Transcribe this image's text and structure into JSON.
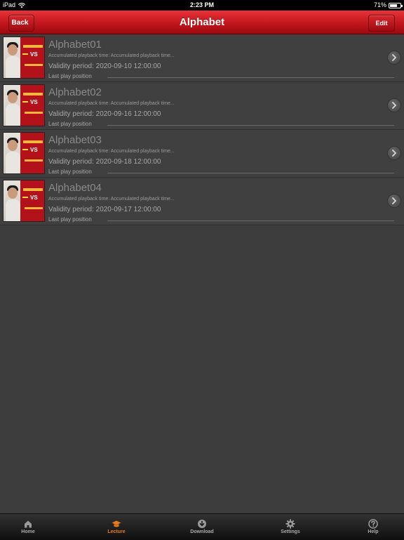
{
  "status_bar": {
    "device": "iPad",
    "time": "2:23 PM",
    "battery_text": "71%",
    "battery_level": 0.71
  },
  "nav": {
    "back_label": "Back",
    "title": "Alphabet",
    "edit_label": "Edit"
  },
  "lectures": [
    {
      "title": "Alphabet01",
      "playback": "Accumulated playback time: Accumulated playback time...",
      "validity": "Validity period: 2020-09-10 12:00:00",
      "last_play": "Last play position",
      "progress": 0
    },
    {
      "title": "Alphabet02",
      "playback": "Accumulated playback time: Accumulated playback time...",
      "validity": "Validity period: 2020-09-16 12:00:00",
      "last_play": "Last play position",
      "progress": 0
    },
    {
      "title": "Alphabet03",
      "playback": "Accumulated playback time: Accumulated playback time...",
      "validity": "Validity period: 2020-09-18 12:00:00",
      "last_play": "Last play position",
      "progress": 0
    },
    {
      "title": "Alphabet04",
      "playback": "Accumulated playback time: Accumulated playback time...",
      "validity": "Validity period: 2020-09-17 12:00:00",
      "last_play": "Last play position",
      "progress": 0
    }
  ],
  "thumbnail_text": "VS",
  "tabs": [
    {
      "label": "Home",
      "icon": "home-icon",
      "active": false
    },
    {
      "label": "Lecture",
      "icon": "graduation-cap-icon",
      "active": true
    },
    {
      "label": "Download",
      "icon": "download-icon",
      "active": false
    },
    {
      "label": "Settings",
      "icon": "gear-icon",
      "active": false
    },
    {
      "label": "Help",
      "icon": "help-icon",
      "active": false
    }
  ],
  "colors": {
    "accent": "#c2161d",
    "active_tab": "#e8791d",
    "background": "#3d3d3d"
  }
}
